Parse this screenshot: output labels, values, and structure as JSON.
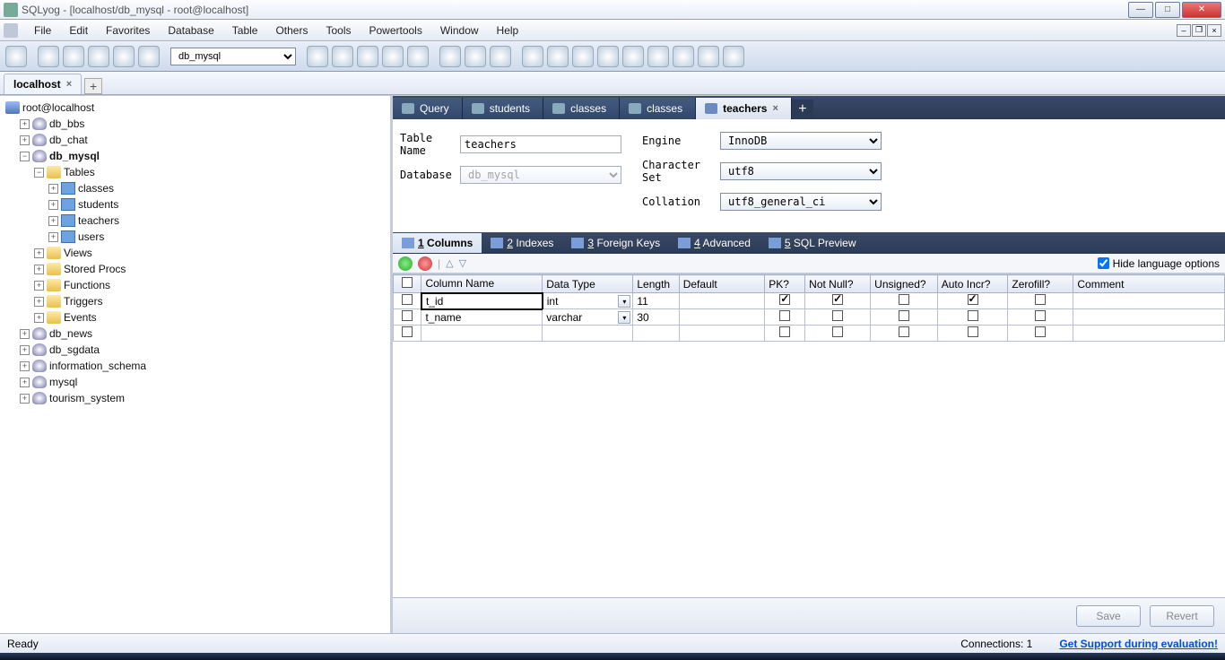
{
  "window": {
    "title": "SQLyog - [localhost/db_mysql - root@localhost]"
  },
  "menu": {
    "items": [
      "File",
      "Edit",
      "Favorites",
      "Database",
      "Table",
      "Others",
      "Tools",
      "Powertools",
      "Window",
      "Help"
    ]
  },
  "toolbar": {
    "db_selected": "db_mysql"
  },
  "doctab": {
    "label": "localhost"
  },
  "tree": {
    "root": "root@localhost",
    "dbs": [
      {
        "name": "db_bbs",
        "expanded": false
      },
      {
        "name": "db_chat",
        "expanded": false
      },
      {
        "name": "db_mysql",
        "expanded": true,
        "bold": true,
        "folders": [
          {
            "name": "Tables",
            "expanded": true,
            "children": [
              "classes",
              "students",
              "teachers",
              "users"
            ]
          },
          {
            "name": "Views"
          },
          {
            "name": "Stored Procs"
          },
          {
            "name": "Functions"
          },
          {
            "name": "Triggers"
          },
          {
            "name": "Events"
          }
        ]
      },
      {
        "name": "db_news",
        "expanded": false
      },
      {
        "name": "db_sgdata",
        "expanded": false
      },
      {
        "name": "information_schema",
        "expanded": false
      },
      {
        "name": "mysql",
        "expanded": false
      },
      {
        "name": "tourism_system",
        "expanded": false
      }
    ]
  },
  "content_tabs": [
    {
      "label": "Query",
      "icon": "query"
    },
    {
      "label": "students",
      "icon": "table"
    },
    {
      "label": "classes",
      "icon": "table"
    },
    {
      "label": "classes",
      "icon": "table"
    },
    {
      "label": "teachers",
      "icon": "table",
      "active": true
    }
  ],
  "form": {
    "table_name_label": "Table Name",
    "table_name": "teachers",
    "database_label": "Database",
    "database": "db_mysql",
    "engine_label": "Engine",
    "engine": "InnoDB",
    "charset_label": "Character Set",
    "charset": "utf8",
    "collation_label": "Collation",
    "collation": "utf8_general_ci"
  },
  "subtabs": [
    {
      "key": "1",
      "label": "Columns",
      "active": true
    },
    {
      "key": "2",
      "label": "Indexes"
    },
    {
      "key": "3",
      "label": "Foreign Keys"
    },
    {
      "key": "4",
      "label": "Advanced"
    },
    {
      "key": "5",
      "label": "SQL Preview"
    }
  ],
  "hide_lang_label": "Hide language options",
  "grid": {
    "headers": [
      "Column Name",
      "Data Type",
      "Length",
      "Default",
      "PK?",
      "Not Null?",
      "Unsigned?",
      "Auto Incr?",
      "Zerofill?",
      "Comment"
    ],
    "rows": [
      {
        "name": "t_id",
        "type": "int",
        "len": "11",
        "def": "",
        "pk": true,
        "nn": true,
        "us": false,
        "ai": true,
        "zf": false,
        "cm": ""
      },
      {
        "name": "t_name",
        "type": "varchar",
        "len": "30",
        "def": "",
        "pk": false,
        "nn": false,
        "us": false,
        "ai": false,
        "zf": false,
        "cm": ""
      },
      {
        "name": "",
        "type": "",
        "len": "",
        "def": "",
        "pk": false,
        "nn": false,
        "us": false,
        "ai": false,
        "zf": false,
        "cm": "",
        "empty": true
      }
    ]
  },
  "footer": {
    "save": "Save",
    "revert": "Revert"
  },
  "status": {
    "ready": "Ready",
    "connections": "Connections: 1",
    "support": "Get Support during evaluation!"
  }
}
